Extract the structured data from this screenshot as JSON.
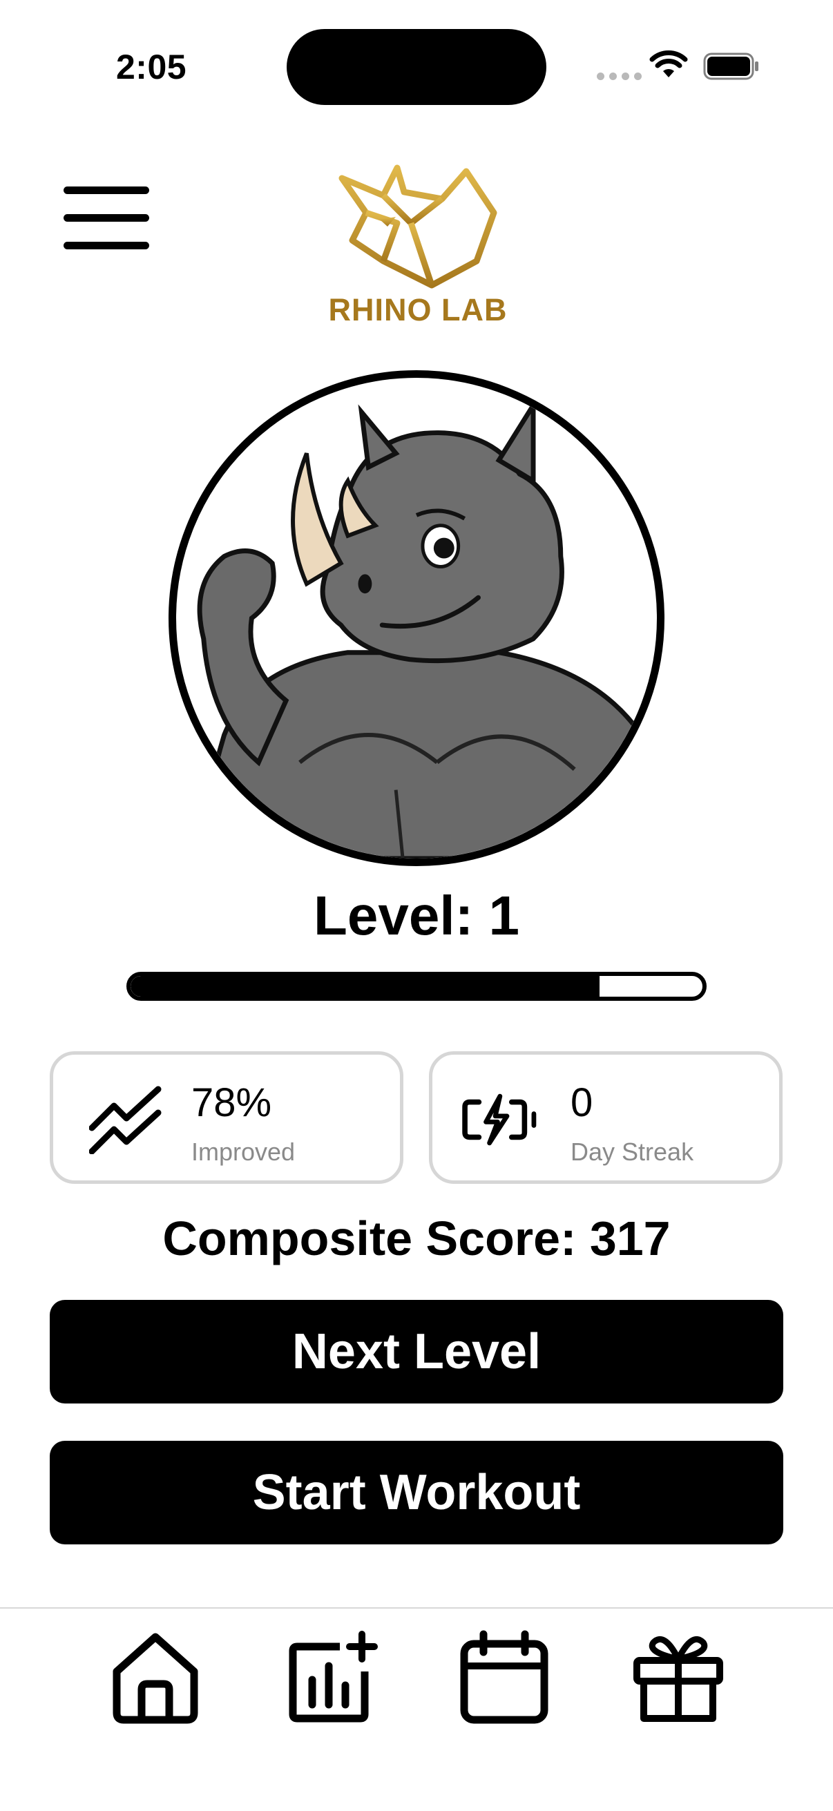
{
  "status_bar": {
    "time": "2:05"
  },
  "header": {
    "logo_text": "RHINO LAB"
  },
  "level": {
    "label": "Level: 1",
    "progress_fraction": 0.82
  },
  "stats": [
    {
      "value": "78%",
      "label": "Improved",
      "icon": "trend-icon"
    },
    {
      "value": "0",
      "label": "Day Streak",
      "icon": "battery-charging-icon"
    }
  ],
  "composite_score": "Composite Score: 317",
  "buttons": {
    "next_level": "Next Level",
    "start_workout": "Start Workout"
  },
  "tab_bar": [
    {
      "name": "home-icon"
    },
    {
      "name": "chart-add-icon"
    },
    {
      "name": "calendar-icon"
    },
    {
      "name": "gift-icon"
    }
  ],
  "colors": {
    "brand_gold": "#a6781d",
    "card_border": "#d6d6d6",
    "muted_text": "#8a8a8a"
  }
}
